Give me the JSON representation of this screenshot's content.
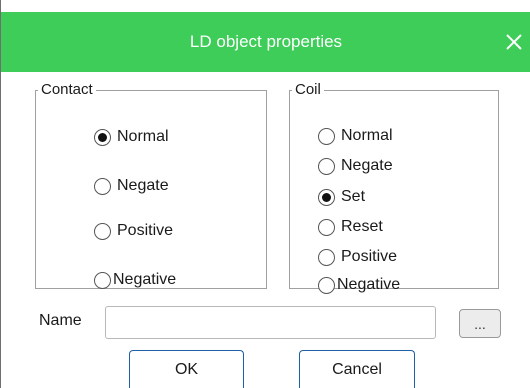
{
  "dialog": {
    "title": "LD object properties",
    "accent_color": "#3dcd58"
  },
  "contact": {
    "legend": "Contact",
    "options": [
      "Normal",
      "Negate",
      "Positive",
      "Negative"
    ],
    "selected": "Normal"
  },
  "coil": {
    "legend": "Coil",
    "options": [
      "Normal",
      "Negate",
      "Set",
      "Reset",
      "Positive",
      "Negative"
    ],
    "selected": "Set"
  },
  "name_field": {
    "label": "Name",
    "value": "",
    "browse_label": "..."
  },
  "buttons": {
    "ok": "OK",
    "cancel": "Cancel"
  }
}
